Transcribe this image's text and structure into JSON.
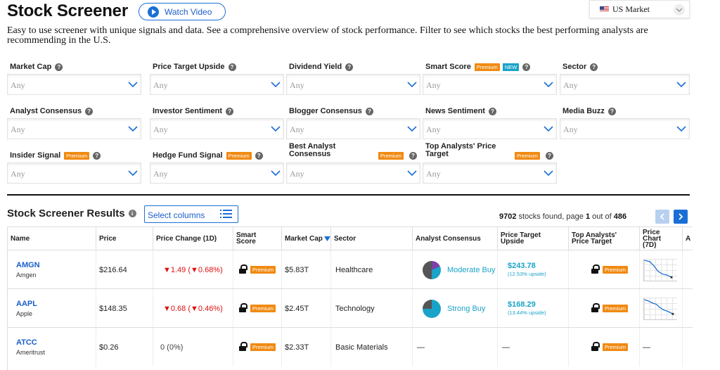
{
  "header": {
    "title": "Stock Screener",
    "watch_video": "Watch Video",
    "market": "US Market",
    "description": "Easy to use screener with unique signals and data. See a comprehensive overview of stock performance. Filter to see which stocks the best performing analysts are recommending in the U.S."
  },
  "badges": {
    "premium": "Premium",
    "new": "NEW"
  },
  "filters": {
    "placeholder": "Any",
    "items": [
      {
        "label": "Market Cap"
      },
      {
        "label": "Price Target Upside"
      },
      {
        "label": "Dividend Yield"
      },
      {
        "label": "Smart Score"
      },
      {
        "label": "Sector"
      },
      {
        "label": "Analyst Consensus"
      },
      {
        "label": "Investor Sentiment"
      },
      {
        "label": "Blogger Consensus"
      },
      {
        "label": "News Sentiment"
      },
      {
        "label": "Media Buzz"
      },
      {
        "label": "Insider Signal"
      },
      {
        "label": "Hedge Fund Signal"
      },
      {
        "label": "Best Analyst Consensus"
      },
      {
        "label": "Top Analysts' Price Target"
      }
    ]
  },
  "results": {
    "title": "Stock Screener Results",
    "select_columns": "Select columns",
    "count": "9702",
    "found_text": "stocks found, page",
    "page": "1",
    "out_of": "out of",
    "total_pages": "486"
  },
  "table": {
    "headers": [
      "Name",
      "Price",
      "Price Change (1D)",
      "Smart Score",
      "Market Cap",
      "Sector",
      "Analyst Consensus",
      "Price Target Upside",
      "Top Analysts' Price Target",
      "Price Chart (7D)",
      "A"
    ],
    "rows": [
      {
        "ticker": "AMGN",
        "company": "Amgen",
        "price": "$216.64",
        "change": "▼1.49 (▼0.68%)",
        "market_cap": "$5.83T",
        "sector": "Healthcare",
        "consensus": "Moderate Buy",
        "target": "$243.78",
        "upside": "(12.53% upside)",
        "chart": true
      },
      {
        "ticker": "AAPL",
        "company": "Apple",
        "price": "$148.35",
        "change": "▼0.68 (▼0.46%)",
        "market_cap": "$2.45T",
        "sector": "Technology",
        "consensus": "Strong Buy",
        "target": "$168.29",
        "upside": "(13.44% upside)",
        "chart": true
      },
      {
        "ticker": "ATCC",
        "company": "Ameritrust",
        "price": "$0.26",
        "change": "0 (0%)",
        "market_cap": "$2.33T",
        "sector": "Basic Materials",
        "consensus": "—",
        "target": "—",
        "upside": "",
        "chart": false,
        "chart_text": "—"
      }
    ]
  },
  "colors": {
    "accent": "#1a6fd6",
    "premium": "#f08a12",
    "teal": "#1aa3c9",
    "negative": "#d11111"
  }
}
